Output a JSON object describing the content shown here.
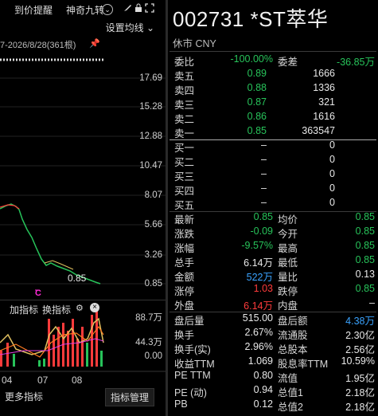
{
  "toolbar": {
    "item1": "到价提醒",
    "item2": "神奇九转",
    "icons": [
      "chevron-down-icon",
      "brush-icon",
      "lock-icon",
      "fullscreen-icon"
    ]
  },
  "chart": {
    "ma_button": "设置均线",
    "range": "7-2026/8/28(361根)",
    "price_ticks": [
      "17.69",
      "15.28",
      "12.88",
      "10.47",
      "8.07",
      "5.66",
      "3.26",
      "0.85"
    ],
    "last_price_label": "0.85",
    "marker": "C",
    "sub_header": {
      "add_indicator": "加指标",
      "switch_indicator": "换指标"
    },
    "volume_ticks": [
      "88.7万",
      "44.3万",
      "0.00"
    ],
    "dates": [
      "04",
      "07",
      "08"
    ],
    "buttons": {
      "more": "更多指标",
      "manage": "指标管理"
    }
  },
  "quote": {
    "title": "002731 *ST萃华",
    "subtitle": "休市 CNY",
    "ratio": {
      "k1": "委比",
      "v1": "-100.00%",
      "k2": "委差",
      "v2": "-36.85万"
    },
    "asks": [
      {
        "label": "卖五",
        "price": "0.89",
        "vol": "1666"
      },
      {
        "label": "卖四",
        "price": "0.88",
        "vol": "1336"
      },
      {
        "label": "卖三",
        "price": "0.87",
        "vol": "321"
      },
      {
        "label": "卖二",
        "price": "0.86",
        "vol": "1616"
      },
      {
        "label": "卖一",
        "price": "0.85",
        "vol": "363547"
      }
    ],
    "bids": [
      {
        "label": "买一",
        "price": "–",
        "vol": "0"
      },
      {
        "label": "买二",
        "price": "–",
        "vol": "0"
      },
      {
        "label": "买三",
        "price": "–",
        "vol": "0"
      },
      {
        "label": "买四",
        "price": "–",
        "vol": "0"
      },
      {
        "label": "买五",
        "price": "–",
        "vol": "0"
      }
    ],
    "stats": [
      {
        "k1": "最新",
        "v1": "0.85",
        "c1": "green",
        "k2": "均价",
        "v2": "0.85",
        "c2": "green"
      },
      {
        "k1": "涨跌",
        "v1": "-0.09",
        "c1": "green",
        "k2": "今开",
        "v2": "0.85",
        "c2": "green"
      },
      {
        "k1": "涨幅",
        "v1": "-9.57%",
        "c1": "green",
        "k2": "最高",
        "v2": "0.85",
        "c2": "green"
      },
      {
        "k1": "总手",
        "v1": "6.14万",
        "c1": "white",
        "k2": "最低",
        "v2": "0.85",
        "c2": "green"
      },
      {
        "k1": "金额",
        "v1": "522万",
        "c1": "blue",
        "k2": "量比",
        "v2": "0.13",
        "c2": "white"
      },
      {
        "k1": "涨停",
        "v1": "1.03",
        "c1": "red",
        "k2": "跌停",
        "v2": "0.85",
        "c2": "green"
      },
      {
        "k1": "外盘",
        "v1": "6.14万",
        "c1": "red",
        "k2": "内盘",
        "v2": "–",
        "c2": "white"
      }
    ],
    "stats2": [
      {
        "k1": "盘后量",
        "v1": "515.00",
        "c1": "white",
        "k2": "盘后额",
        "v2": "4.38万",
        "c2": "blue"
      },
      {
        "k1": "换手",
        "v1": "2.67%",
        "c1": "white",
        "k2": "流通股",
        "v2": "2.30亿",
        "c2": "white"
      },
      {
        "k1": "换手(实)",
        "v1": "2.96%",
        "c1": "white",
        "k2": "总股本",
        "v2": "2.56亿",
        "c2": "white"
      },
      {
        "k1": "收益TTM",
        "v1": "1.069",
        "c1": "white",
        "k2": "股息率TTM",
        "v2": "10.59%",
        "c2": "white"
      },
      {
        "k1": "PE TTM",
        "v1": "0.80",
        "c1": "white",
        "k2": "流值",
        "v2": "1.95亿",
        "c2": "white"
      },
      {
        "k1": "PE (动)",
        "v1": "0.94",
        "c1": "white",
        "k2": "总值1",
        "v2": "2.18亿",
        "c2": "white"
      },
      {
        "k1": "PB",
        "v1": "0.12",
        "c1": "white",
        "k2": "总值2",
        "v2": "2.18亿",
        "c2": "white"
      }
    ]
  },
  "colors": {
    "up": "#ff3b3b",
    "down": "#27c35a",
    "blue": "#3aa3ff",
    "bg": "#000000"
  }
}
